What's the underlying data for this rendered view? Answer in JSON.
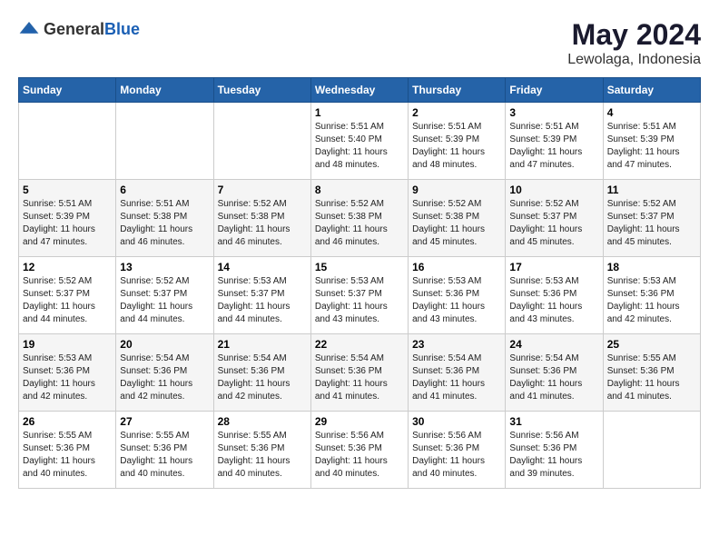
{
  "header": {
    "logo": {
      "text_general": "General",
      "text_blue": "Blue"
    },
    "title": "May 2024",
    "location": "Lewolaga, Indonesia"
  },
  "calendar": {
    "days_of_week": [
      "Sunday",
      "Monday",
      "Tuesday",
      "Wednesday",
      "Thursday",
      "Friday",
      "Saturday"
    ],
    "weeks": [
      [
        {
          "day": "",
          "info": ""
        },
        {
          "day": "",
          "info": ""
        },
        {
          "day": "",
          "info": ""
        },
        {
          "day": "1",
          "info": "Sunrise: 5:51 AM\nSunset: 5:40 PM\nDaylight: 11 hours\nand 48 minutes."
        },
        {
          "day": "2",
          "info": "Sunrise: 5:51 AM\nSunset: 5:39 PM\nDaylight: 11 hours\nand 48 minutes."
        },
        {
          "day": "3",
          "info": "Sunrise: 5:51 AM\nSunset: 5:39 PM\nDaylight: 11 hours\nand 47 minutes."
        },
        {
          "day": "4",
          "info": "Sunrise: 5:51 AM\nSunset: 5:39 PM\nDaylight: 11 hours\nand 47 minutes."
        }
      ],
      [
        {
          "day": "5",
          "info": "Sunrise: 5:51 AM\nSunset: 5:39 PM\nDaylight: 11 hours\nand 47 minutes."
        },
        {
          "day": "6",
          "info": "Sunrise: 5:51 AM\nSunset: 5:38 PM\nDaylight: 11 hours\nand 46 minutes."
        },
        {
          "day": "7",
          "info": "Sunrise: 5:52 AM\nSunset: 5:38 PM\nDaylight: 11 hours\nand 46 minutes."
        },
        {
          "day": "8",
          "info": "Sunrise: 5:52 AM\nSunset: 5:38 PM\nDaylight: 11 hours\nand 46 minutes."
        },
        {
          "day": "9",
          "info": "Sunrise: 5:52 AM\nSunset: 5:38 PM\nDaylight: 11 hours\nand 45 minutes."
        },
        {
          "day": "10",
          "info": "Sunrise: 5:52 AM\nSunset: 5:37 PM\nDaylight: 11 hours\nand 45 minutes."
        },
        {
          "day": "11",
          "info": "Sunrise: 5:52 AM\nSunset: 5:37 PM\nDaylight: 11 hours\nand 45 minutes."
        }
      ],
      [
        {
          "day": "12",
          "info": "Sunrise: 5:52 AM\nSunset: 5:37 PM\nDaylight: 11 hours\nand 44 minutes."
        },
        {
          "day": "13",
          "info": "Sunrise: 5:52 AM\nSunset: 5:37 PM\nDaylight: 11 hours\nand 44 minutes."
        },
        {
          "day": "14",
          "info": "Sunrise: 5:53 AM\nSunset: 5:37 PM\nDaylight: 11 hours\nand 44 minutes."
        },
        {
          "day": "15",
          "info": "Sunrise: 5:53 AM\nSunset: 5:37 PM\nDaylight: 11 hours\nand 43 minutes."
        },
        {
          "day": "16",
          "info": "Sunrise: 5:53 AM\nSunset: 5:36 PM\nDaylight: 11 hours\nand 43 minutes."
        },
        {
          "day": "17",
          "info": "Sunrise: 5:53 AM\nSunset: 5:36 PM\nDaylight: 11 hours\nand 43 minutes."
        },
        {
          "day": "18",
          "info": "Sunrise: 5:53 AM\nSunset: 5:36 PM\nDaylight: 11 hours\nand 42 minutes."
        }
      ],
      [
        {
          "day": "19",
          "info": "Sunrise: 5:53 AM\nSunset: 5:36 PM\nDaylight: 11 hours\nand 42 minutes."
        },
        {
          "day": "20",
          "info": "Sunrise: 5:54 AM\nSunset: 5:36 PM\nDaylight: 11 hours\nand 42 minutes."
        },
        {
          "day": "21",
          "info": "Sunrise: 5:54 AM\nSunset: 5:36 PM\nDaylight: 11 hours\nand 42 minutes."
        },
        {
          "day": "22",
          "info": "Sunrise: 5:54 AM\nSunset: 5:36 PM\nDaylight: 11 hours\nand 41 minutes."
        },
        {
          "day": "23",
          "info": "Sunrise: 5:54 AM\nSunset: 5:36 PM\nDaylight: 11 hours\nand 41 minutes."
        },
        {
          "day": "24",
          "info": "Sunrise: 5:54 AM\nSunset: 5:36 PM\nDaylight: 11 hours\nand 41 minutes."
        },
        {
          "day": "25",
          "info": "Sunrise: 5:55 AM\nSunset: 5:36 PM\nDaylight: 11 hours\nand 41 minutes."
        }
      ],
      [
        {
          "day": "26",
          "info": "Sunrise: 5:55 AM\nSunset: 5:36 PM\nDaylight: 11 hours\nand 40 minutes."
        },
        {
          "day": "27",
          "info": "Sunrise: 5:55 AM\nSunset: 5:36 PM\nDaylight: 11 hours\nand 40 minutes."
        },
        {
          "day": "28",
          "info": "Sunrise: 5:55 AM\nSunset: 5:36 PM\nDaylight: 11 hours\nand 40 minutes."
        },
        {
          "day": "29",
          "info": "Sunrise: 5:56 AM\nSunset: 5:36 PM\nDaylight: 11 hours\nand 40 minutes."
        },
        {
          "day": "30",
          "info": "Sunrise: 5:56 AM\nSunset: 5:36 PM\nDaylight: 11 hours\nand 40 minutes."
        },
        {
          "day": "31",
          "info": "Sunrise: 5:56 AM\nSunset: 5:36 PM\nDaylight: 11 hours\nand 39 minutes."
        },
        {
          "day": "",
          "info": ""
        }
      ]
    ]
  }
}
